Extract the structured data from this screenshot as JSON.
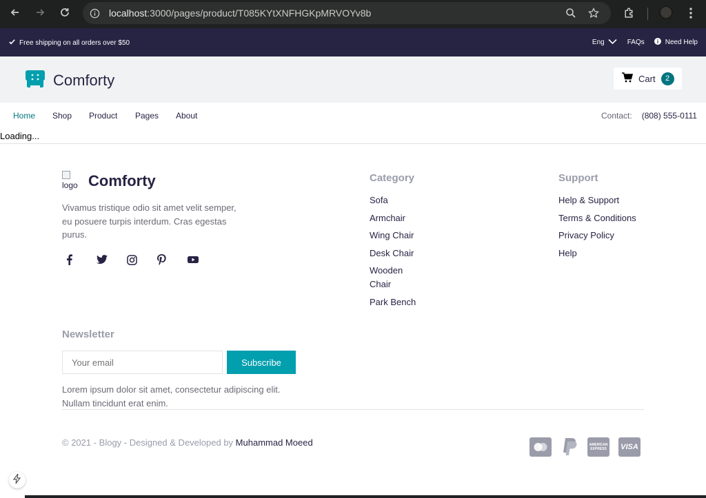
{
  "browser": {
    "url_host": "localhost",
    "url_rest": ":3000/pages/product/T085KYtXNFHGKpMRVOYv8b"
  },
  "topbar": {
    "shipping_text": "Free shipping on all orders over $50",
    "language": "Eng",
    "faqs": "FAQs",
    "help": "Need Help"
  },
  "header": {
    "brand": "Comforty",
    "cart_label": "Cart",
    "cart_count": "2"
  },
  "nav": {
    "items": [
      {
        "label": "Home",
        "active": true
      },
      {
        "label": "Shop"
      },
      {
        "label": "Product"
      },
      {
        "label": "Pages"
      },
      {
        "label": "About"
      }
    ],
    "contact_label": "Contact:",
    "contact_phone": "(808) 555-0111"
  },
  "main": {
    "loading_text": "Loading..."
  },
  "footer": {
    "logo_alt": "logo",
    "brand": "Comforty",
    "description": "Vivamus tristique odio sit amet velit semper, eu posuere turpis interdum. Cras egestas purus.",
    "socials": [
      "facebook-icon",
      "twitter-icon",
      "instagram-icon",
      "pinterest-icon",
      "youtube-icon"
    ],
    "category": {
      "title": "Category",
      "items": [
        "Sofa",
        "Armchair",
        "Wing Chair",
        "Desk Chair",
        "Wooden Chair",
        "Park Bench"
      ]
    },
    "support": {
      "title": "Support",
      "items": [
        "Help & Support",
        "Terms & Conditions",
        "Privacy Policy",
        "Help"
      ]
    },
    "newsletter": {
      "title": "Newsletter",
      "placeholder": "Your email",
      "button": "Subscribe",
      "description": "Lorem ipsum dolor sit amet, consectetur adipiscing elit. Nullam tincidunt erat enim."
    },
    "copyright": "© 2021 - Blogy - Designed & Developed by ",
    "author": "Muhammad Moeed",
    "payments": [
      "mastercard-icon",
      "paypal-icon",
      "amex-icon",
      "visa-icon"
    ],
    "payment_labels": {
      "amex": "AMERICAN EXPRESS",
      "visa": "VISA"
    }
  },
  "colors": {
    "primary_dark": "#272343",
    "accent": "#007580",
    "button": "#029fae",
    "muted": "#9a9caa",
    "header_bg": "#f0f2f3"
  }
}
